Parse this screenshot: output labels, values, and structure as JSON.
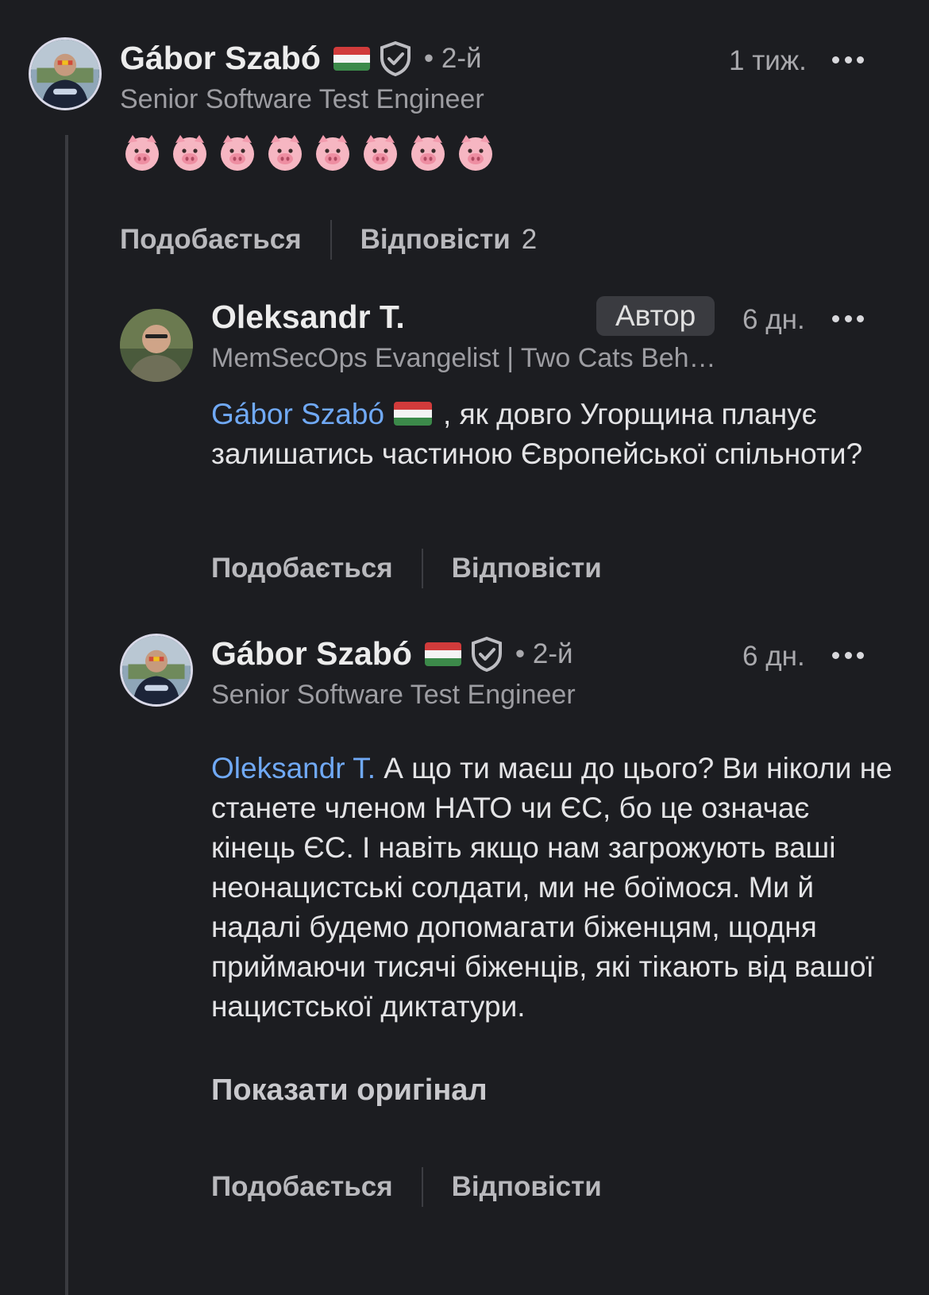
{
  "colors": {
    "background": "#1c1d21",
    "mention": "#70a9f5",
    "thread_line": "#3a3b40"
  },
  "comment1": {
    "author": "Gábor Szabó",
    "flag": "hungary-flag",
    "verified_icon": "shield-check-icon",
    "degree": "• 2-й",
    "headline": "Senior Software Test Engineer",
    "time": "1 тиж.",
    "body_emoji": [
      "🐷",
      "🐷",
      "🐷",
      "🐷",
      "🐷",
      "🐷",
      "🐷",
      "🐷"
    ],
    "like_label": "Подобається",
    "reply_label": "Відповісти",
    "reply_count": "2"
  },
  "comment2": {
    "author": "Oleksandr T.",
    "badge": "Автор",
    "headline": "MemSecOps Evangelist | Two Cats Beh…",
    "time": "6 дн.",
    "mention": "Gábor Szabó",
    "text_after_mention": ",  як довго Угорщина планує залишатись частиною Європейської спільноти?",
    "like_label": "Подобається",
    "reply_label": "Відповісти"
  },
  "comment3": {
    "author": "Gábor Szabó",
    "flag": "hungary-flag",
    "verified_icon": "shield-check-icon",
    "degree": "• 2-й",
    "headline": "Senior Software Test Engineer",
    "time": "6 дн.",
    "mention": "Oleksandr T.",
    "text_after_mention": " А що ти маєш до цього? Ви ніколи не станете членом НАТО чи ЄС, бо це означає кінець ЄС. І навіть якщо нам загрожують ваші неонацистські солдати, ми не боїмося. Ми й надалі будемо допомагати біженцям, щодня приймаючи тисячі біженців, які тікають від вашої нацистської диктатури.",
    "show_original_label": "Показати оригінал",
    "like_label": "Подобається",
    "reply_label": "Відповісти"
  }
}
